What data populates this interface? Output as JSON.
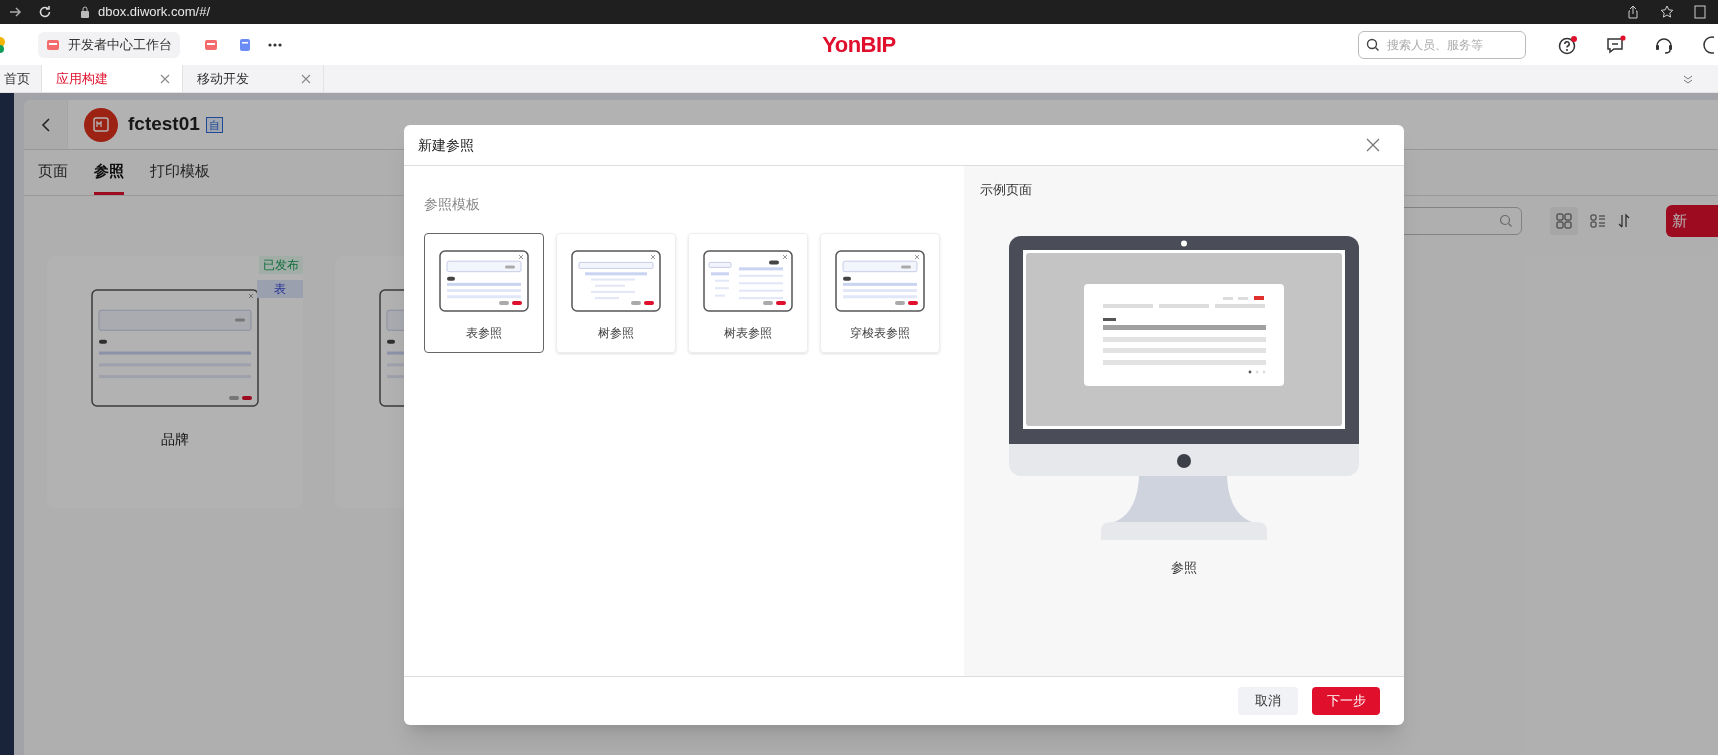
{
  "browser": {
    "url": "dbox.diwork.com/#/"
  },
  "header": {
    "workbench_tab": "开发者中心工作台",
    "logo": "YonBIP",
    "search": {
      "placeholder": "搜索人员、服务等"
    }
  },
  "tabs": [
    {
      "label": "首页",
      "selected": false,
      "closable": false
    },
    {
      "label": "应用构建",
      "selected": true,
      "closable": true
    },
    {
      "label": "移动开发",
      "selected": false,
      "closable": true
    }
  ],
  "app": {
    "name": "fctest01",
    "badge": "自",
    "subtabs": [
      {
        "label": "页面",
        "selected": false
      },
      {
        "label": "参照",
        "selected": true
      },
      {
        "label": "打印模板",
        "selected": false
      }
    ],
    "new_button": "新",
    "cards": [
      {
        "name": "品牌",
        "status": "已发布",
        "type": "表",
        "kind": "table"
      },
      {
        "kind": "table"
      }
    ]
  },
  "dialog": {
    "title": "新建参照",
    "section_title": "参照模板",
    "templates": [
      {
        "label": "表参照",
        "selected": true,
        "kind": "table"
      },
      {
        "label": "树参照",
        "selected": false,
        "kind": "tree"
      },
      {
        "label": "树表参照",
        "selected": false,
        "kind": "tree_table"
      },
      {
        "label": "穿梭表参照",
        "selected": false,
        "kind": "table"
      }
    ],
    "preview_title": "示例页面",
    "preview_caption": "参照",
    "buttons": [
      {
        "label": "取消",
        "kind": "secondary"
      },
      {
        "label": "下一步",
        "kind": "primary"
      }
    ]
  }
}
